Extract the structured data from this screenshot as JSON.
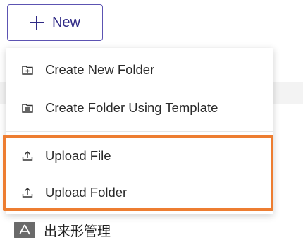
{
  "new_button": {
    "label": "New",
    "icon": "plus-icon"
  },
  "menu": {
    "items": [
      {
        "label": "Create New Folder",
        "icon": "folder-plus-icon"
      },
      {
        "label": "Create Folder Using Template",
        "icon": "folder-template-icon"
      },
      {
        "label": "Upload File",
        "icon": "upload-icon"
      },
      {
        "label": "Upload Folder",
        "icon": "upload-icon"
      }
    ]
  },
  "background_row": {
    "label": "出来形管理",
    "icon": "folder-people-icon"
  },
  "colors": {
    "accent": "#5c53b2",
    "accent_text": "#2f2a86",
    "highlight": "#ed7d31"
  }
}
